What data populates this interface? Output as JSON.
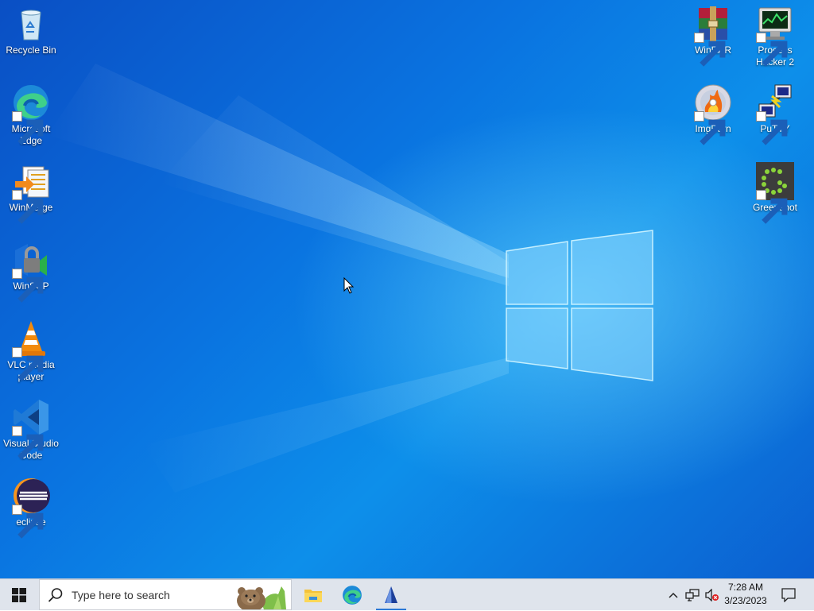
{
  "desktop": {
    "icons_left": [
      {
        "label": "Recycle Bin",
        "icon": "recycle-bin-icon"
      },
      {
        "label": "Microsoft Edge",
        "icon": "edge-icon"
      },
      {
        "label": "WinMerge",
        "icon": "winmerge-icon"
      },
      {
        "label": "WinSCP",
        "icon": "winscp-icon"
      },
      {
        "label": "VLC media player",
        "icon": "vlc-icon"
      },
      {
        "label": "Visual Studio Code",
        "icon": "vscode-icon"
      },
      {
        "label": "eclipse",
        "icon": "eclipse-icon"
      }
    ],
    "icons_right": [
      {
        "label": "WinRAR",
        "icon": "winrar-icon"
      },
      {
        "label": "Process Hacker 2",
        "icon": "process-hacker-icon"
      },
      {
        "label": "ImgBurn",
        "icon": "imgburn-icon"
      },
      {
        "label": "PuTTY",
        "icon": "putty-icon"
      },
      {
        "label": "Greenshot",
        "icon": "greenshot-icon"
      }
    ]
  },
  "taskbar": {
    "start_icon": "windows-logo-icon",
    "search": {
      "placeholder": "Type here to search",
      "icon": "search-icon"
    },
    "pinned": [
      {
        "name": "File Explorer",
        "icon": "file-explorer-icon"
      },
      {
        "name": "Microsoft Edge",
        "icon": "edge-icon"
      },
      {
        "name": "Application",
        "icon": "app-icon"
      }
    ],
    "tray": {
      "chevron": "chevron-up-icon",
      "network": "network-icon",
      "volume": "volume-muted-icon",
      "time": "7:28 AM",
      "date": "3/23/2023",
      "notifications": "notification-icon"
    }
  },
  "colors": {
    "accent": "#2d7ad6",
    "taskbar_bg": "#dfe4ec",
    "wallpaper": "#0a73e0"
  }
}
